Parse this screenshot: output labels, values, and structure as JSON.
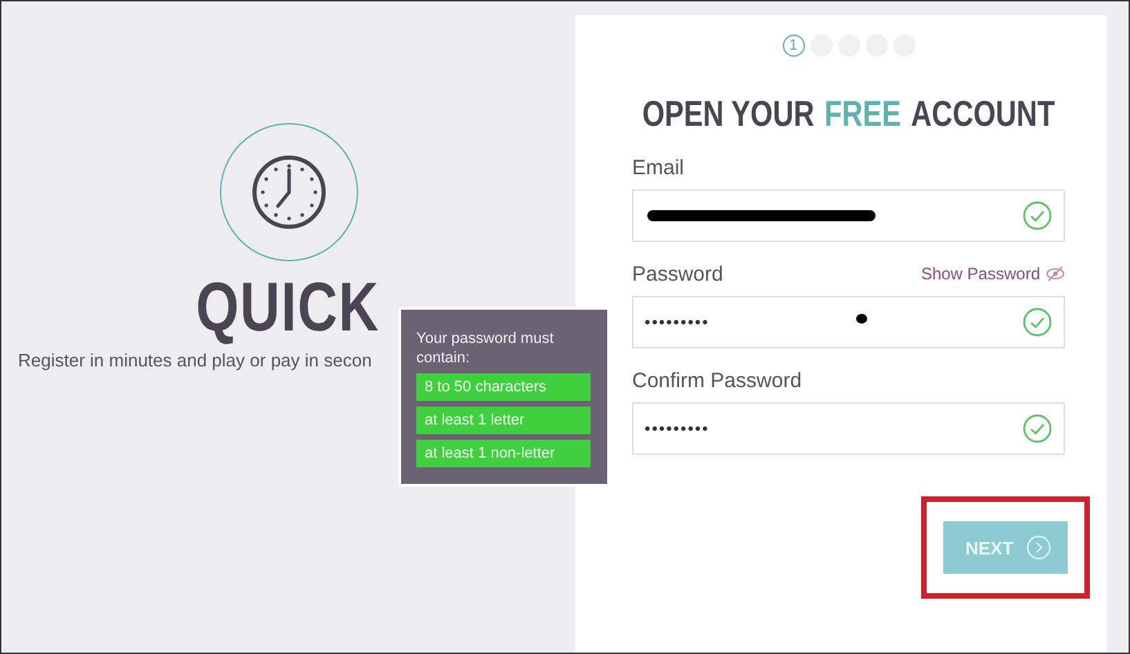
{
  "left_panel": {
    "headline": "QUICK",
    "subtitle": "Register in minutes and play or pay in secon"
  },
  "tooltip": {
    "title": "Your password must contain:",
    "rules": [
      {
        "text": "8 to 50 characters",
        "met": true
      },
      {
        "text": "at least 1 letter",
        "met": true
      },
      {
        "text": "at least 1 non-letter",
        "met": true
      }
    ]
  },
  "steps": [
    {
      "label": "1",
      "selected": true
    },
    {
      "selected": false
    },
    {
      "selected": false
    },
    {
      "selected": false
    },
    {
      "selected": false
    }
  ],
  "title_parts": [
    {
      "text": "OPEN YOUR",
      "highlight": false
    },
    {
      "text": "FREE",
      "highlight": true
    },
    {
      "text": "ACCOUNT",
      "highlight": false
    }
  ],
  "fields": [
    {
      "label": "Email",
      "redacted": true,
      "valid": true
    },
    {
      "label": "Password",
      "value": "•••••••••",
      "valid": true,
      "link": "Show Password"
    },
    {
      "label": "Confirm Password",
      "value": "•••••••••",
      "valid": true
    }
  ],
  "next_button": {
    "label": "NEXT",
    "highlighted": true
  }
}
